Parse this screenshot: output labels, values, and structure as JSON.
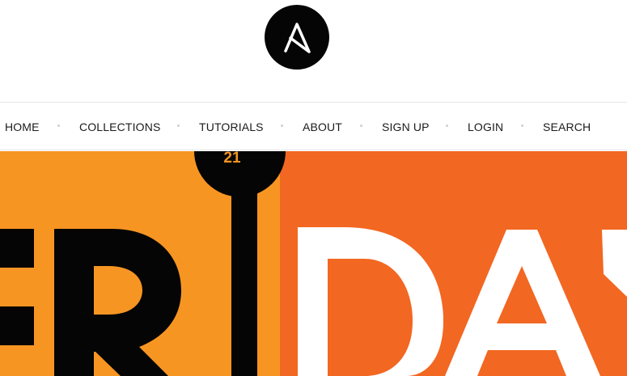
{
  "brand": {
    "logo_letter": "A",
    "logo_icon": "ansible-logo-icon",
    "logo_bg": "#050505",
    "logo_fg": "#ffffff"
  },
  "nav": {
    "items": [
      {
        "label": "HOME"
      },
      {
        "label": "COLLECTIONS"
      },
      {
        "label": "TUTORIALS"
      },
      {
        "label": "ABOUT"
      },
      {
        "label": "SIGN UP"
      },
      {
        "label": "LOGIN"
      },
      {
        "label": "SEARCH"
      }
    ]
  },
  "hero": {
    "left_bg": "#f79522",
    "right_bg": "#f26722",
    "dark": "#050505",
    "light": "#ffffff",
    "badge_text": "21"
  }
}
